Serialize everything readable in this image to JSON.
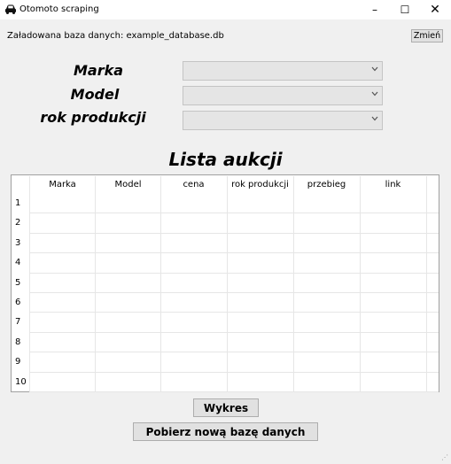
{
  "window": {
    "title": "Otomoto scraping",
    "minimize": "–",
    "maximize": "☐",
    "close": "✕"
  },
  "database": {
    "label": "Załadowana baza danych:",
    "filename": "example_database.db",
    "change_button": "Zmień"
  },
  "filters": {
    "marka_label": "Marka",
    "model_label": "Model",
    "rok_label": "rok produkcji",
    "marka_value": "",
    "model_value": "",
    "rok_value": ""
  },
  "list": {
    "title": "Lista aukcji",
    "columns": [
      "Marka",
      "Model",
      "cena",
      "rok produkcji",
      "przebieg",
      "link"
    ],
    "row_numbers": [
      "1",
      "2",
      "3",
      "4",
      "5",
      "6",
      "7",
      "8",
      "9",
      "10"
    ]
  },
  "buttons": {
    "chart": "Wykres",
    "fetch": "Pobierz nową bazę danych"
  },
  "icons": {
    "app": "car-icon",
    "dropdown": "chevron-down-icon",
    "resize": "resize-grip-icon"
  }
}
